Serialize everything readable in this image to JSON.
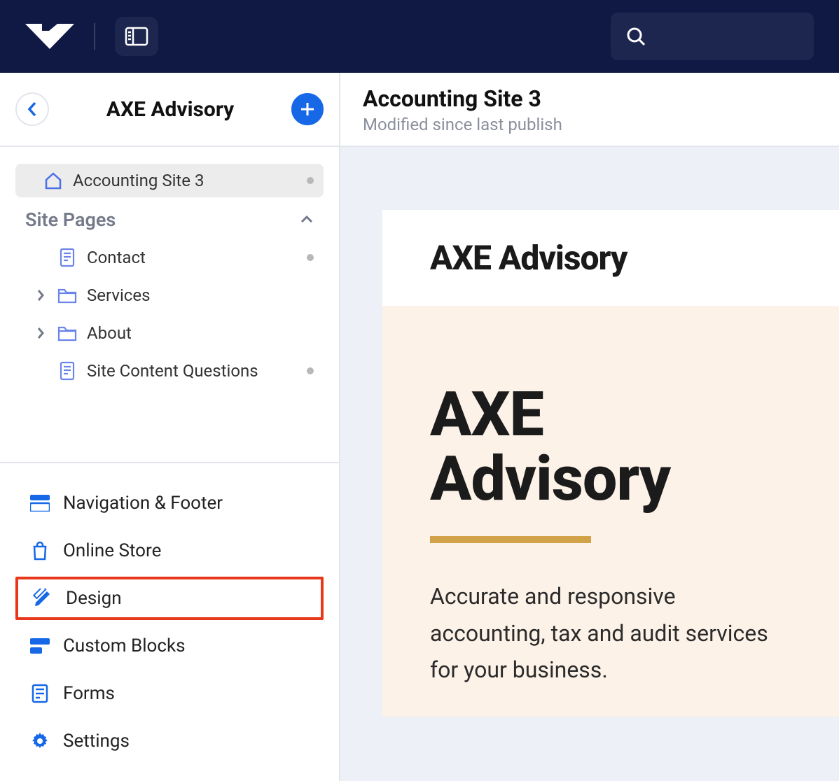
{
  "header": {
    "panel_title": "AXE Advisory"
  },
  "tree": {
    "root": {
      "label": "Accounting Site 3",
      "has_dot": true,
      "selected": true
    },
    "section_label": "Site Pages",
    "pages": [
      {
        "label": "Contact",
        "icon": "page",
        "has_dot": true,
        "expandable": false
      },
      {
        "label": "Services",
        "icon": "folder",
        "has_dot": false,
        "expandable": true
      },
      {
        "label": "About",
        "icon": "folder",
        "has_dot": false,
        "expandable": true
      },
      {
        "label": "Site Content Questions",
        "icon": "page",
        "has_dot": true,
        "expandable": false
      }
    ]
  },
  "bottom_nav": [
    {
      "label": "Navigation & Footer",
      "icon": "layout",
      "highlighted": false
    },
    {
      "label": "Online Store",
      "icon": "bag",
      "highlighted": false
    },
    {
      "label": "Design",
      "icon": "pencil-ruler",
      "highlighted": true
    },
    {
      "label": "Custom Blocks",
      "icon": "blocks",
      "highlighted": false
    },
    {
      "label": "Forms",
      "icon": "form",
      "highlighted": false
    },
    {
      "label": "Settings",
      "icon": "gear",
      "highlighted": false
    }
  ],
  "preview": {
    "title": "Accounting Site 3",
    "subtitle": "Modified since last publish",
    "site_brand": "AXE Advisory",
    "hero_title": "AXE Advisory",
    "hero_text": "Accurate and responsive accounting, tax and audit services for your business."
  },
  "colors": {
    "accent": "#1768e6",
    "topbar": "#0f1943",
    "highlight_border": "#e8381b",
    "hero_bg": "#fcf2e8",
    "hero_rule": "#d1a248"
  }
}
